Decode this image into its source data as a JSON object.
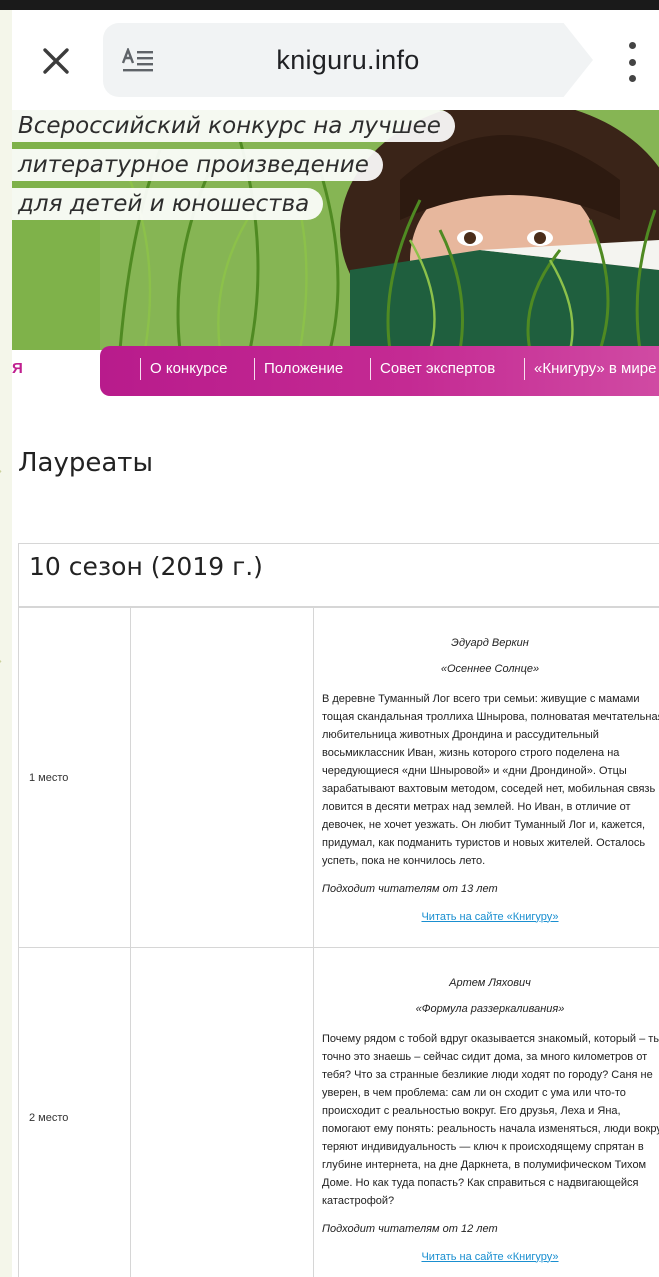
{
  "browser": {
    "url": "kniguru.info",
    "close_icon": "close-icon",
    "reader_icon": "reader-mode-icon",
    "menu_icon": "more-vert-icon"
  },
  "banner": {
    "tagline": [
      "Всероссийский конкурс на лучшее",
      "литературное произведение",
      "для детей и юношества"
    ],
    "left_mark": "Я",
    "nav": [
      "О конкурсе",
      "Положение",
      "Совет экспертов",
      "«Книгуру» в мире"
    ]
  },
  "page": {
    "heading": "Лауреаты",
    "season": "10 сезон (2019 г.)"
  },
  "laureates": [
    {
      "place": "1 место",
      "author": "Эдуард Веркин",
      "book": "«Осеннее Солнце»",
      "description": "В деревне Туманный Лог всего три семьи: живущие с мамами тощая скандальная троллиха Шнырова, полноватая мечтательная любительница животных Дрондина и рассудительный восьмиклассник Иван, жизнь которого строго поделена на чередующиеся «дни Шныровой» и «дни Дрондиной». Отцы зарабатывают вахтовым методом, соседей нет, мобильная связь ловится в десяти метрах над землей. Но Иван, в отличие от девочек, не хочет уезжать. Он любит Туманный Лог и, кажется, придумал, как подманить туристов и новых жителей. Осталось успеть, пока не кончилось лето.",
      "age": "Подходит читателям от 13 лет",
      "link": "Читать на сайте «Книгуру»"
    },
    {
      "place": "2 место",
      "author": "Артем Ляхович",
      "book": "«Формула раззеркаливания»",
      "description": "Почему рядом с тобой вдруг оказывается знакомый, который – ты точно это знаешь – сейчас сидит дома, за много километров от тебя? Что за странные безликие люди ходят по городу? Саня не уверен, в чем проблема: сам ли он сходит с ума или что-то происходит с реальностью вокруг. Его друзья, Леха и Яна, помогают ему понять: реальность начала изменяться, люди вокруг теряют индивидуальность — ключ к происходящему спрятан в глубине интернета, на дне Даркнета, в полумифическом Тихом Доме. Но как туда попасть? Как справиться с надвигающейся катастрофой?",
      "age": "Подходит читателям от 12 лет",
      "link": "Читать на сайте «Книгуру»"
    }
  ]
}
